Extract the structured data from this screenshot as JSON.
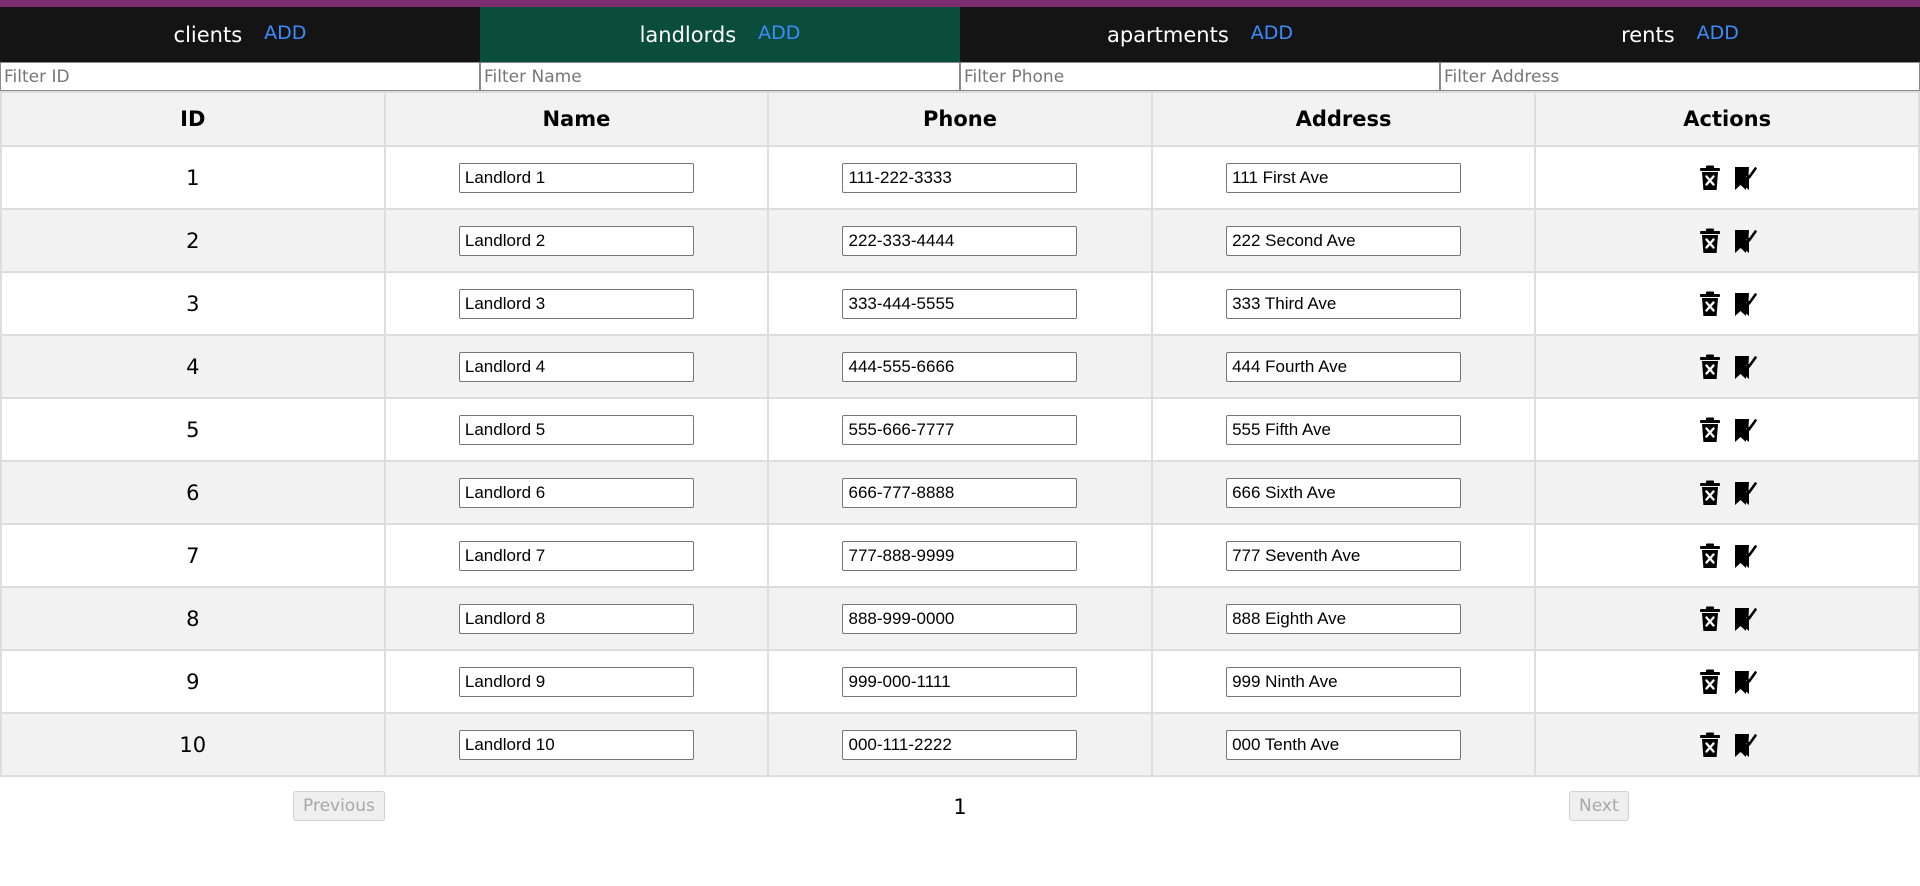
{
  "colors": {
    "top_strip": "#7b2d6f",
    "navbar_bg": "#141414",
    "active_tab_bg": "#0a4d3a",
    "add_link": "#3b8cff",
    "row_alt": "#f2f2f2"
  },
  "nav": {
    "tabs": [
      {
        "label": "clients",
        "add": "ADD"
      },
      {
        "label": "landlords",
        "add": "ADD"
      },
      {
        "label": "apartments",
        "add": "ADD"
      },
      {
        "label": "rents",
        "add": "ADD"
      }
    ],
    "active": "landlords"
  },
  "filters": {
    "id": "Filter ID",
    "name": "Filter Name",
    "phone": "Filter Phone",
    "address": "Filter Address"
  },
  "table": {
    "headers": [
      "ID",
      "Name",
      "Phone",
      "Address",
      "Actions"
    ],
    "rows": [
      {
        "id": "1",
        "name": "Landlord 1",
        "phone": "111-222-3333",
        "address": "111 First Ave"
      },
      {
        "id": "2",
        "name": "Landlord 2",
        "phone": "222-333-4444",
        "address": "222 Second Ave"
      },
      {
        "id": "3",
        "name": "Landlord 3",
        "phone": "333-444-5555",
        "address": "333 Third Ave"
      },
      {
        "id": "4",
        "name": "Landlord 4",
        "phone": "444-555-6666",
        "address": "444 Fourth Ave"
      },
      {
        "id": "5",
        "name": "Landlord 5",
        "phone": "555-666-7777",
        "address": "555 Fifth Ave"
      },
      {
        "id": "6",
        "name": "Landlord 6",
        "phone": "666-777-8888",
        "address": "666 Sixth Ave"
      },
      {
        "id": "7",
        "name": "Landlord 7",
        "phone": "777-888-9999",
        "address": "777 Seventh Ave"
      },
      {
        "id": "8",
        "name": "Landlord 8",
        "phone": "888-999-0000",
        "address": "888 Eighth Ave"
      },
      {
        "id": "9",
        "name": "Landlord 9",
        "phone": "999-000-1111",
        "address": "999 Ninth Ave"
      },
      {
        "id": "10",
        "name": "Landlord 10",
        "phone": "000-111-2222",
        "address": "000 Tenth Ave"
      }
    ],
    "row_actions": [
      "delete-icon",
      "bookmark-check-icon"
    ]
  },
  "pagination": {
    "previous": "Previous",
    "page": "1",
    "next": "Next"
  }
}
